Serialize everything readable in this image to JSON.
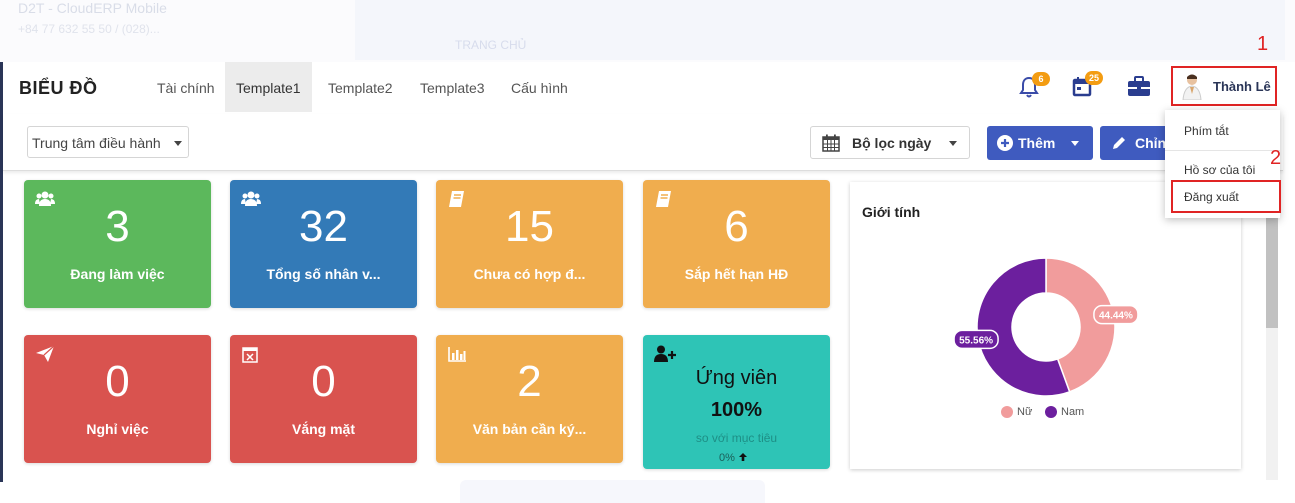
{
  "background": {
    "app_title": "D2T - CloudERP Mobile",
    "app_subtitle": "+84 77 632 55 50 / (028)...",
    "ghost_text": "TRANG CHỦ"
  },
  "header": {
    "brand": "BIỂU ĐỒ",
    "tabs": [
      {
        "label": "Tài chính",
        "active": false
      },
      {
        "label": "Template1",
        "active": true
      },
      {
        "label": "Template2",
        "active": false
      },
      {
        "label": "Template3",
        "active": false
      },
      {
        "label": "Cấu hình",
        "active": false
      }
    ],
    "notifications_count": "6",
    "calendar_count": "25",
    "user_name": "Thành Lê"
  },
  "toolbar": {
    "dashboard_select": "Trung tâm điều hành",
    "date_filter": "Bộ lọc ngày",
    "add_button": "Thêm",
    "edit_button": "Chỉnh"
  },
  "user_menu": {
    "items": [
      "Phím tắt",
      "Hồ sơ của tôi",
      "Đăng xuất"
    ]
  },
  "annotations": [
    "1",
    "2"
  ],
  "cards": [
    {
      "value": "3",
      "label": "Đang làm việc",
      "color": "#5cb85c",
      "icon": "users-icon"
    },
    {
      "value": "32",
      "label": "Tổng số nhân v...",
      "color": "#337ab7",
      "icon": "users-icon"
    },
    {
      "value": "15",
      "label": "Chưa có hợp đ...",
      "color": "#f0ad4e",
      "icon": "book-icon"
    },
    {
      "value": "6",
      "label": "Sắp hết hạn HĐ",
      "color": "#f0ad4e",
      "icon": "book-icon"
    },
    {
      "value": "0",
      "label": "Nghỉ việc",
      "color": "#d9534f",
      "icon": "paper-plane-icon"
    },
    {
      "value": "0",
      "label": "Vắng mặt",
      "color": "#d9534f",
      "icon": "calendar-x-icon"
    },
    {
      "value": "2",
      "label": "Văn bản cần ký...",
      "color": "#f0ad4e",
      "icon": "bar-chart-icon"
    }
  ],
  "candidate_card": {
    "title": "Ứng viên",
    "percent": "100%",
    "subtitle": "so với mục tiêu",
    "change": "0%",
    "color": "#2ec4b6",
    "icon": "user-plus-icon"
  },
  "gender_chart": {
    "title": "Giới tính",
    "chart_data": {
      "type": "pie",
      "categories": [
        "Nữ",
        "Nam"
      ],
      "values": [
        44.44,
        55.56
      ],
      "labels": [
        "44.44%",
        "55.56%"
      ],
      "colors": [
        "#f19c9c",
        "#6c1f9e"
      ],
      "legend": "bottom"
    }
  }
}
